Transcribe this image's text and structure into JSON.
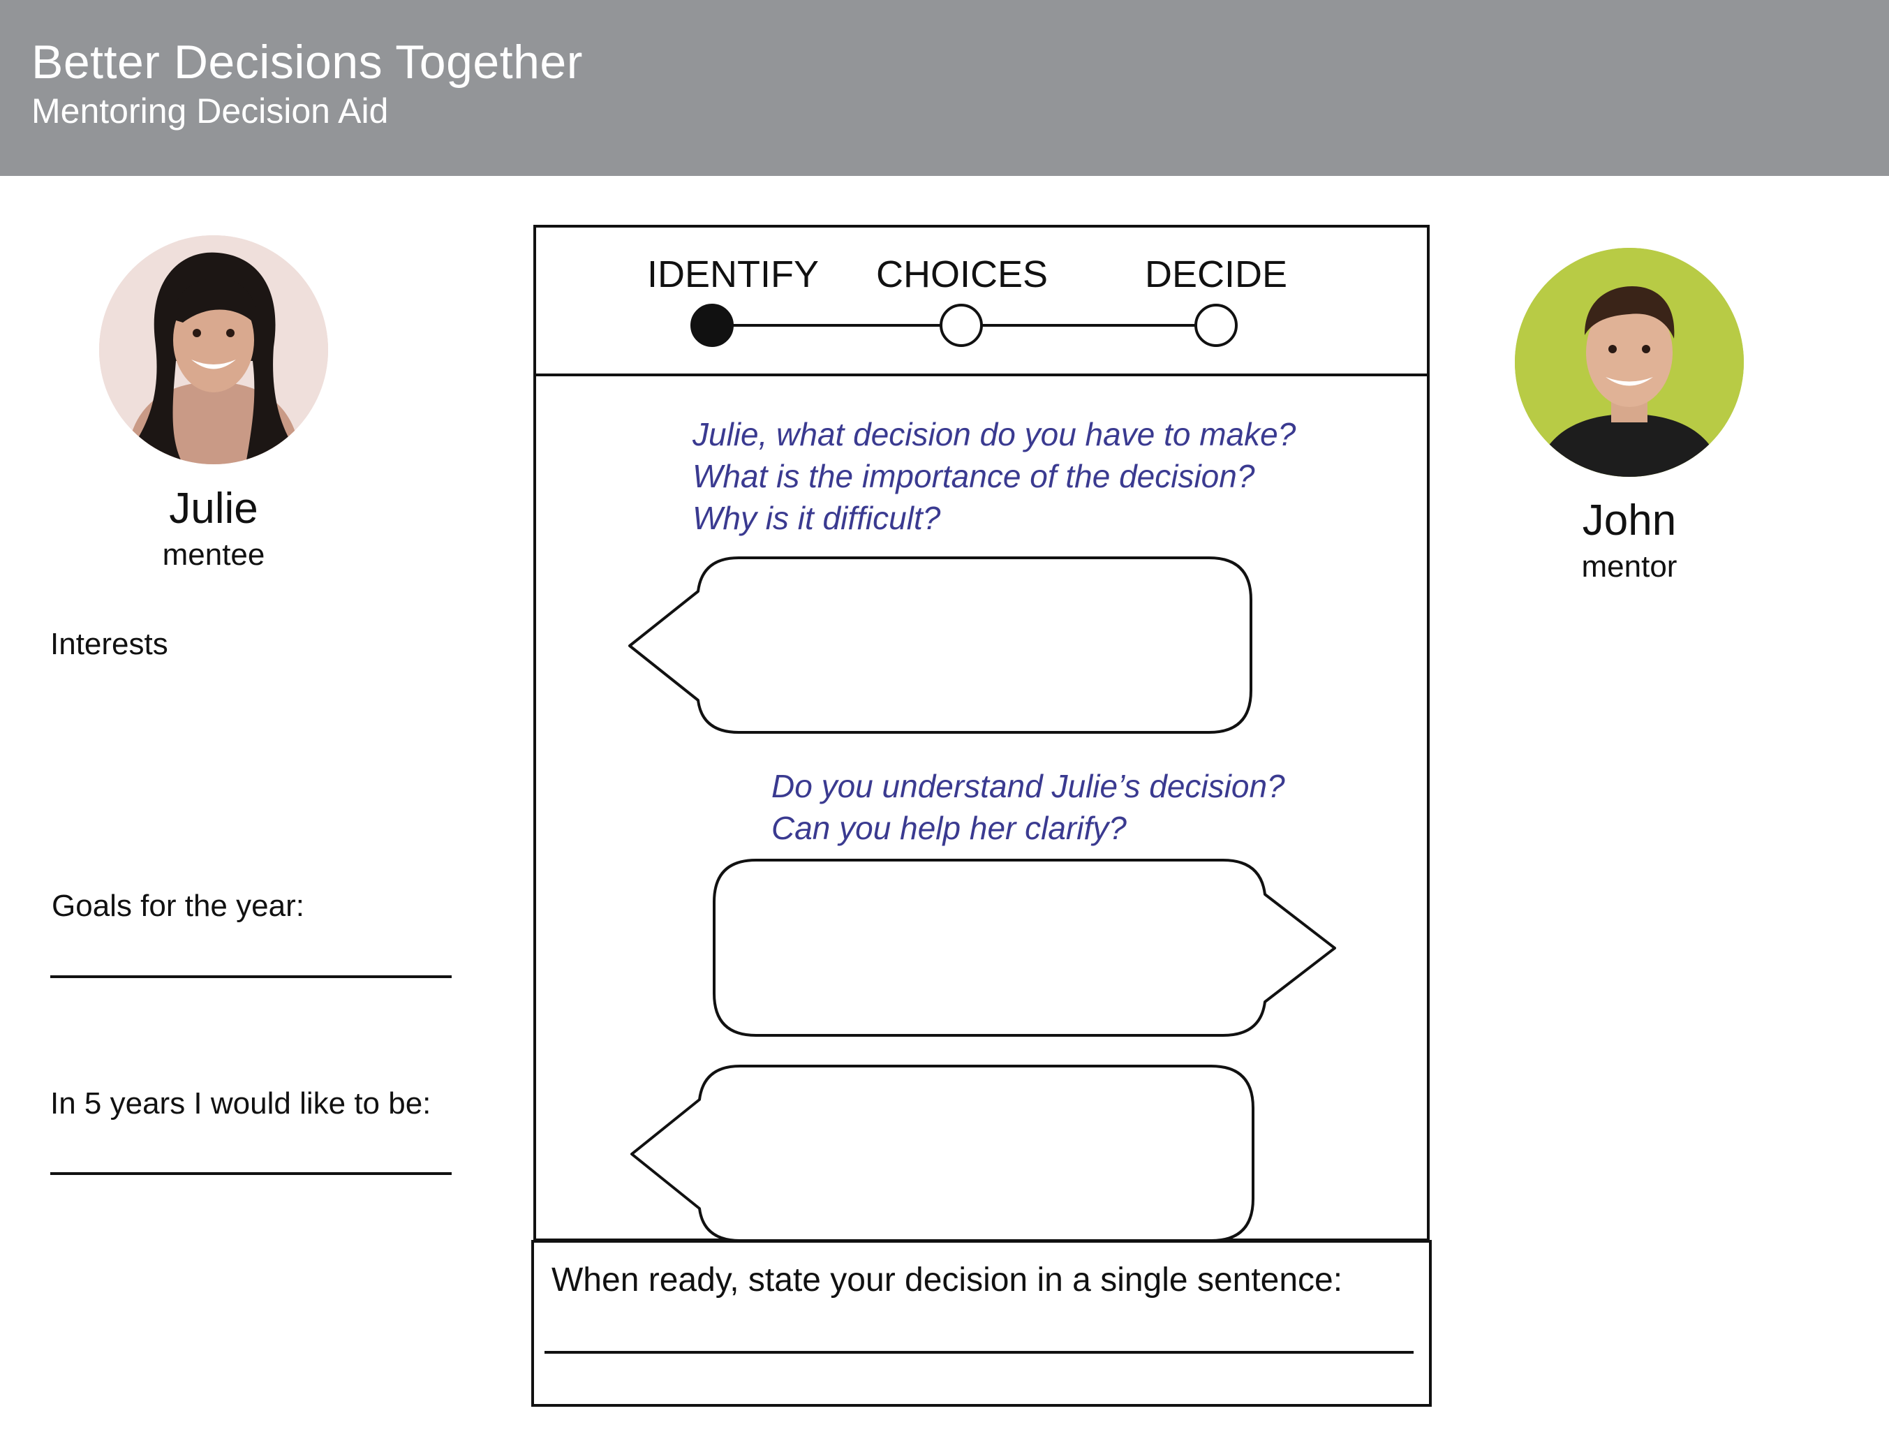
{
  "header": {
    "title": "Better Decisions Together",
    "subtitle": "Mentoring Decision Aid"
  },
  "mentee": {
    "name": "Julie",
    "role": "mentee",
    "avatar_icon": "mentee-photo"
  },
  "mentor": {
    "name": "John",
    "role": "mentor",
    "avatar_icon": "mentor-photo"
  },
  "sidebar": {
    "interests_label": "Interests",
    "goals_label": "Goals for the year:",
    "five_years_label": "In 5 years I would like to be:",
    "goals_value": "",
    "five_years_value": ""
  },
  "stepper": {
    "steps": [
      {
        "label": "IDENTIFY",
        "state": "active"
      },
      {
        "label": "CHOICES",
        "state": "inactive"
      },
      {
        "label": "DECIDE",
        "state": "inactive"
      }
    ]
  },
  "conversation": {
    "mentee_prompt": [
      "Julie, what decision do you have to make?",
      "What is the importance of the decision?",
      "Why is it difficult?"
    ],
    "mentor_prompt": [
      "Do you understand Julie’s decision?",
      "Can you help her clarify?"
    ],
    "bubbles": [
      {
        "speaker": "mentee",
        "text": ""
      },
      {
        "speaker": "mentor",
        "text": ""
      },
      {
        "speaker": "mentee",
        "text": ""
      }
    ]
  },
  "footer": {
    "decision_label": "When ready, state your decision in a single sentence:",
    "decision_value": ""
  },
  "colors": {
    "header_bg": "#939598",
    "prompt_text": "#3a3a90",
    "mentor_bg": "#b5c942"
  }
}
